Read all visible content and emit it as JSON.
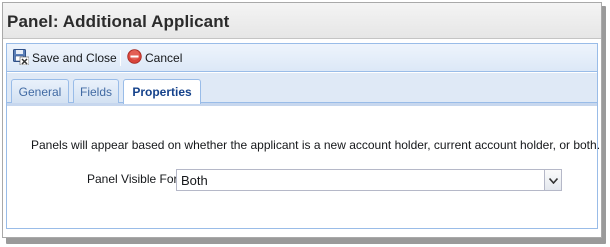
{
  "header": {
    "title": "Panel: Additional Applicant"
  },
  "toolbar": {
    "save_label": "Save and Close",
    "cancel_label": "Cancel"
  },
  "tabs": [
    {
      "label": "General",
      "active": false
    },
    {
      "label": "Fields",
      "active": false
    },
    {
      "label": "Properties",
      "active": true
    }
  ],
  "properties": {
    "description": "Panels will appear based on whether the applicant is a new account holder, current account holder, or both.",
    "visible_for_label": "Panel Visible For:",
    "visible_for_value": "Both"
  },
  "icons": {
    "save": "save-close-icon",
    "cancel": "cancel-icon",
    "dropdown": "chevron-down-icon"
  },
  "colors": {
    "panel_border": "#99bce8",
    "active_tab_text": "#15428b",
    "tab_text": "#416aa3",
    "cancel_red": "#d9443a"
  }
}
